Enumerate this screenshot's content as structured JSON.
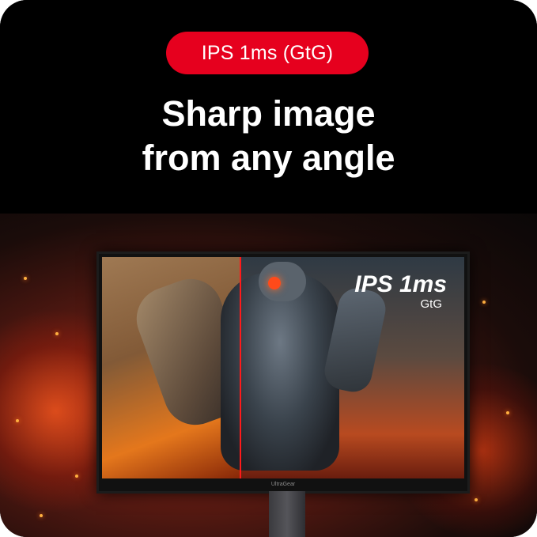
{
  "badge": {
    "label": "IPS 1ms (GtG)"
  },
  "headline": {
    "line1": "Sharp image",
    "line2": "from any angle"
  },
  "monitor": {
    "logo_main": "IPS 1ms",
    "logo_sub": "GtG",
    "bezel_brand": "UltraGear"
  },
  "colors": {
    "badge_bg": "#e6001e",
    "divider": "#ff1a1a",
    "background": "#000000"
  }
}
